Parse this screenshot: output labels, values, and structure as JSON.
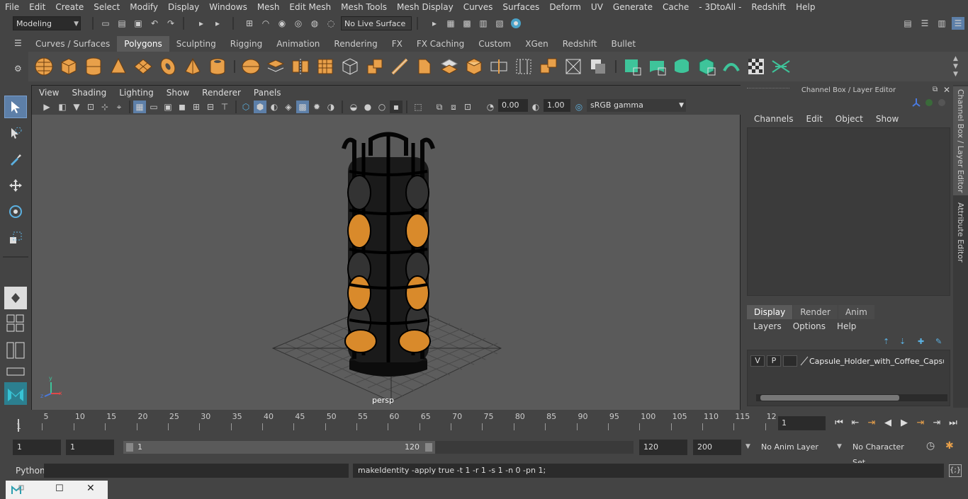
{
  "menubar": {
    "items": [
      "File",
      "Edit",
      "Create",
      "Select",
      "Modify",
      "Display",
      "Windows",
      "Mesh",
      "Edit Mesh",
      "Mesh Tools",
      "Mesh Display",
      "Curves",
      "Surfaces",
      "Deform",
      "UV",
      "Generate",
      "Cache",
      "- 3DtoAll -",
      "Redshift",
      "Help"
    ]
  },
  "statusline": {
    "mode": "Modeling",
    "live_surface": "No Live Surface"
  },
  "shelf": {
    "tabs": [
      "Curves / Surfaces",
      "Polygons",
      "Sculpting",
      "Rigging",
      "Animation",
      "Rendering",
      "FX",
      "FX Caching",
      "Custom",
      "XGen",
      "Redshift",
      "Bullet"
    ],
    "active_tab": "Polygons"
  },
  "viewport": {
    "menu": [
      "View",
      "Shading",
      "Lighting",
      "Show",
      "Renderer",
      "Panels"
    ],
    "exposure": "0.00",
    "gamma": "1.00",
    "colorspace": "sRGB gamma",
    "camera_label": "persp"
  },
  "channelbox": {
    "title": "Channel Box / Layer Editor",
    "menu": [
      "Channels",
      "Edit",
      "Object",
      "Show"
    ]
  },
  "layer_editor": {
    "tabs": [
      "Display",
      "Render",
      "Anim"
    ],
    "active_tab": "Display",
    "menu": [
      "Layers",
      "Options",
      "Help"
    ],
    "layer": {
      "v": "V",
      "p": "P",
      "name": "Capsule_Holder_with_Coffee_Capsul"
    }
  },
  "side_tabs": [
    "Channel Box / Layer Editor",
    "Attribute Editor"
  ],
  "timeslider": {
    "ticks": [
      "5",
      "10",
      "15",
      "20",
      "25",
      "30",
      "35",
      "40",
      "45",
      "50",
      "55",
      "60",
      "65",
      "70",
      "75",
      "80",
      "85",
      "90",
      "95",
      "100",
      "105",
      "110",
      "115",
      "12"
    ],
    "start_label": "1",
    "current_frame": "1"
  },
  "range": {
    "start": "1",
    "anim_start": "1",
    "slider_start": "1",
    "slider_end": "120",
    "end": "120",
    "anim_end": "200",
    "anim_layer": "No Anim Layer",
    "character_set": "No Character Set"
  },
  "cmdline": {
    "lang": "Python",
    "output": "makeIdentity -apply true -t 1 -r 1 -s 1 -n 0 -pn 1;"
  },
  "colors": {
    "bg": "#444444",
    "viewport_bg": "#5a5a5a",
    "shelf_orange": "#e8a04a",
    "shelf_green": "#3ec49a",
    "active_blue": "#5d7fa8"
  }
}
